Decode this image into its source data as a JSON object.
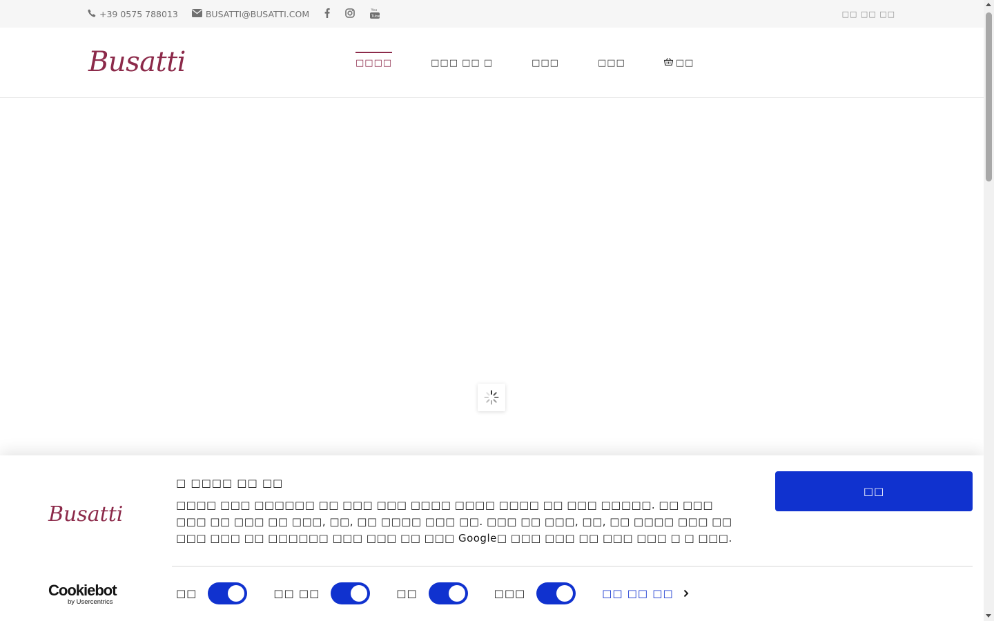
{
  "topbar": {
    "phone": "+39 0575 788013",
    "email": "BUSATTI@BUSATTI.COM",
    "social": [
      "facebook-icon",
      "instagram-icon",
      "youtube-icon"
    ],
    "right_link": "□□ □□ □□"
  },
  "header": {
    "logo": "Busatti",
    "nav": [
      {
        "label": "□□□□",
        "active": true
      },
      {
        "label": "□□□ □□ □",
        "active": false
      },
      {
        "label": "□□□",
        "active": false
      },
      {
        "label": "□□□",
        "active": false
      },
      {
        "label": "□□",
        "active": false,
        "icon": "basket-icon"
      }
    ]
  },
  "cookie_banner": {
    "logo": "Busatti",
    "title": "□ □□□□ □□ □□",
    "body": "□□□□ □□□ □□□□□□ □□ □□□ □□□ □□□□ □□□□ □□□□ □□ □□□ □□□□□. □□ □□□ □□□ □□ □□□ □□ □□□, □□, □□ □□□□ □□□ □□. □□□ □□ □□□, □□, □□ □□□□ □□□ □□ □□□ □□□ □□ □□□□□□ □□□ □□□ □□ □□□ Google□ □□□ □□□ □□ □□□ □□□ □ □ □□□.",
    "allow_button": "□□",
    "toggles": [
      {
        "label": "□□",
        "on": true
      },
      {
        "label": "□□ □□",
        "on": true
      },
      {
        "label": "□□",
        "on": true
      },
      {
        "label": "□□□",
        "on": true
      }
    ],
    "details_link": "□□ □□ □□",
    "cookiebot_brand": "Cookiebot",
    "cookiebot_by": "by Usercentrics"
  },
  "colors": {
    "brand": "#8c2a4a",
    "accent": "#1032cf",
    "topbar_bg": "#f6f6f6"
  }
}
